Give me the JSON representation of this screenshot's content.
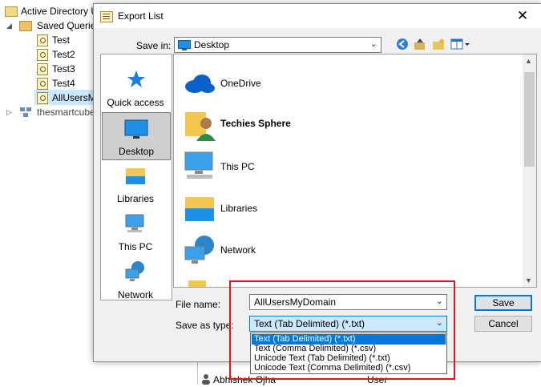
{
  "tree": {
    "root_label": "Active Directory U",
    "saved_queries_label": "Saved Querie",
    "queries": [
      "Test",
      "Test2",
      "Test3",
      "Test4",
      "AllUsersM"
    ],
    "domain_label": "thesmartcube"
  },
  "dialog": {
    "title": "Export List",
    "close_glyph": "✕",
    "save_in_label": "Save in:",
    "save_in_value": "Desktop",
    "places": [
      "Quick access",
      "Desktop",
      "Libraries",
      "This PC",
      "Network"
    ],
    "files": [
      "OneDrive",
      "Techies Sphere",
      "This PC",
      "Libraries",
      "Network"
    ],
    "filename_label": "File name:",
    "filename_value": "AllUsersMyDomain",
    "save_as_type_label": "Save as type:",
    "save_as_type_value": "Text (Tab Delimited) (*.txt)",
    "type_options": [
      "Text (Tab Delimited) (*.txt)",
      "Text (Comma Delimited) (*.csv)",
      "Unicode Text (Tab Delimited) (*.txt)",
      "Unicode Text (Comma Delimited) (*.csv)"
    ],
    "save_button": "Save",
    "cancel_button": "Cancel"
  },
  "background_row": {
    "name": "Abhishek Ojha",
    "type": "User"
  },
  "colors": {
    "accent": "#0078d7",
    "highlight_box": "#e0151b"
  }
}
